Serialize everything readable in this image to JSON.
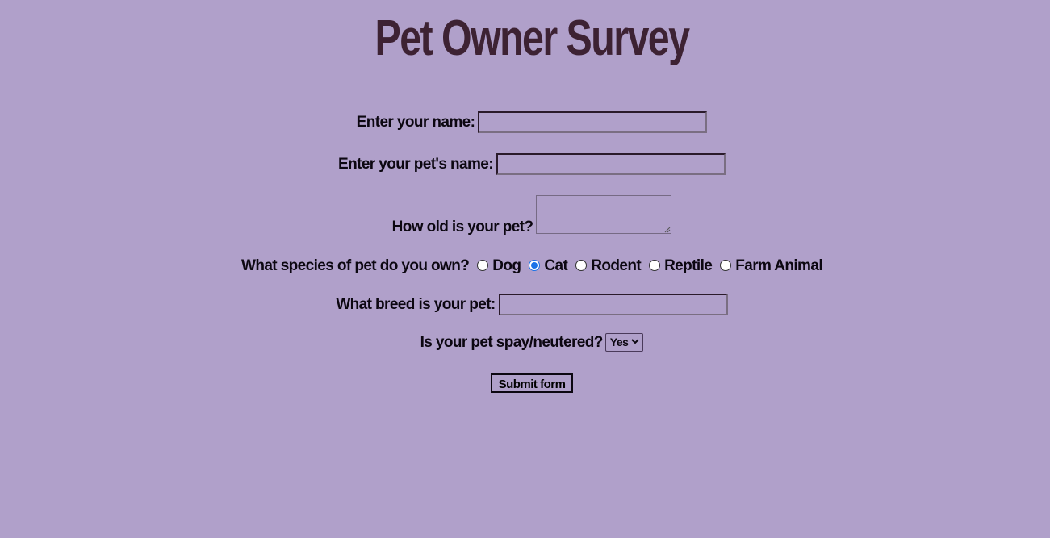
{
  "page": {
    "title": "Pet Owner Survey",
    "background_color": "#b0a0ca",
    "title_color": "#3d2233",
    "accent_color": "#1a73e8"
  },
  "form": {
    "owner_name": {
      "label": "Enter your name:",
      "value": ""
    },
    "pet_name": {
      "label": "Enter your pet's name:",
      "value": ""
    },
    "pet_age": {
      "label": "How old is your pet?",
      "value": ""
    },
    "species": {
      "label": "What species of pet do you own?",
      "options": [
        "Dog",
        "Cat",
        "Rodent",
        "Reptile",
        "Farm Animal"
      ],
      "selected": "Cat"
    },
    "breed": {
      "label": "What breed is your pet:",
      "value": ""
    },
    "spayed": {
      "label": "Is your pet spay/neutered?",
      "selected": "Yes",
      "icon": "chevron-down-icon"
    },
    "submit_label": "Submit form"
  }
}
